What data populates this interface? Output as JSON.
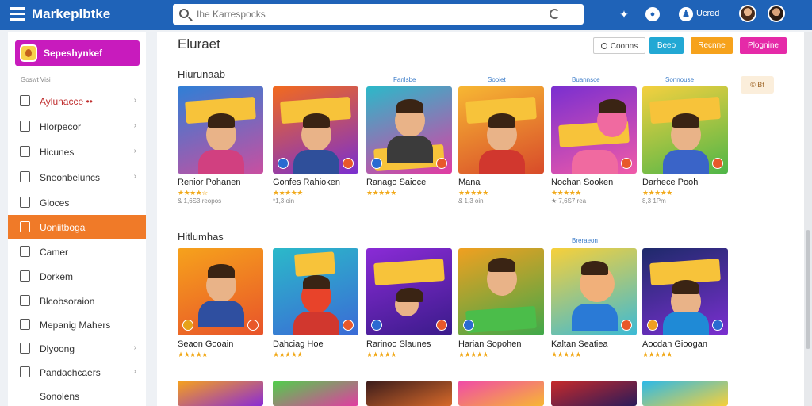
{
  "app": {
    "brand": "Markeplbtke"
  },
  "search": {
    "placeholder": "Ihe Karrespocks"
  },
  "header": {
    "user_label": "Ucred"
  },
  "sidebar": {
    "profile_label": "Sepeshynkef",
    "section_label": "Goswt Visi",
    "items": [
      {
        "label": "Aylunacce ••",
        "chevron": "›"
      },
      {
        "label": "Hlorpecor",
        "chevron": "›"
      },
      {
        "label": "Hicunes",
        "chevron": "›"
      },
      {
        "label": "Sneonbeluncs",
        "chevron": "›"
      },
      {
        "label": "Gloces",
        "chevron": ""
      },
      {
        "label": "Uoniitboga",
        "chevron": ""
      },
      {
        "label": "Camer",
        "chevron": ""
      },
      {
        "label": "Dorkem",
        "chevron": ""
      },
      {
        "label": "Blcobsoraion",
        "chevron": ""
      },
      {
        "label": "Mepanig Mahers",
        "chevron": ""
      },
      {
        "label": "Dlyoong",
        "chevron": "›"
      },
      {
        "label": "Pandachcaers",
        "chevron": "›"
      },
      {
        "label": "Sonolens",
        "chevron": ""
      }
    ]
  },
  "main": {
    "title": "Eluraet",
    "sort": {
      "search": "Coonns",
      "teal": "Beeo",
      "orange": "Recnne",
      "pink": "Plognine"
    },
    "more": "© Bt",
    "section1": {
      "title": "Hiurunaab",
      "tags": [
        "Fanlsbe",
        "Sooiet",
        "Buannsce",
        "Sonnouse"
      ],
      "cards": [
        {
          "title": "Renior Pohanen",
          "stars": "★★★★☆",
          "meta": "& 1,6S3 reopos"
        },
        {
          "title": "Gonfes Rahioken",
          "stars": "★★★★★",
          "meta": "*1,3 oin"
        },
        {
          "title": "Ranago Saioce",
          "stars": "★★★★★",
          "meta": ""
        },
        {
          "title": "Mana",
          "stars": "★★★★★",
          "meta": "& 1,3 oin"
        },
        {
          "title": "Nochan Sooken",
          "stars": "★★★★★",
          "meta": "★ 7,6S7 rea"
        },
        {
          "title": "Darhece Pooh",
          "stars": "★★★★★",
          "meta": "8,3 1Pm"
        }
      ]
    },
    "section2": {
      "title": "Hitlumhas",
      "tag": "Breraeon",
      "cards": [
        {
          "title": "Seaon Gooain",
          "stars": "★★★★★",
          "meta": ""
        },
        {
          "title": "Dahciag Hoe",
          "stars": "★★★★★",
          "meta": ""
        },
        {
          "title": "Rarinoo Slaunes",
          "stars": "★★★★★",
          "meta": ""
        },
        {
          "title": "Harian Sopohen",
          "stars": "★★★★★",
          "meta": ""
        },
        {
          "title": "Kaltan Seatiea",
          "stars": "★★★★★",
          "meta": ""
        },
        {
          "title": "Aocdan Gioogan",
          "stars": "★★★★★",
          "meta": ""
        }
      ]
    }
  },
  "colors": {
    "header": "#1f63b8",
    "active_nav": "#f07a28",
    "profile": "#c81bbd",
    "star": "#f1a817",
    "sort_teal": "#22a8d4",
    "sort_orange": "#f6a21c",
    "sort_pink": "#e52aa8"
  },
  "icons": {
    "menu": "menu-icon",
    "search": "search-icon",
    "loading": "loading-icon",
    "notifications": "notification-icon",
    "chat": "chat-icon",
    "user": "user-icon"
  }
}
